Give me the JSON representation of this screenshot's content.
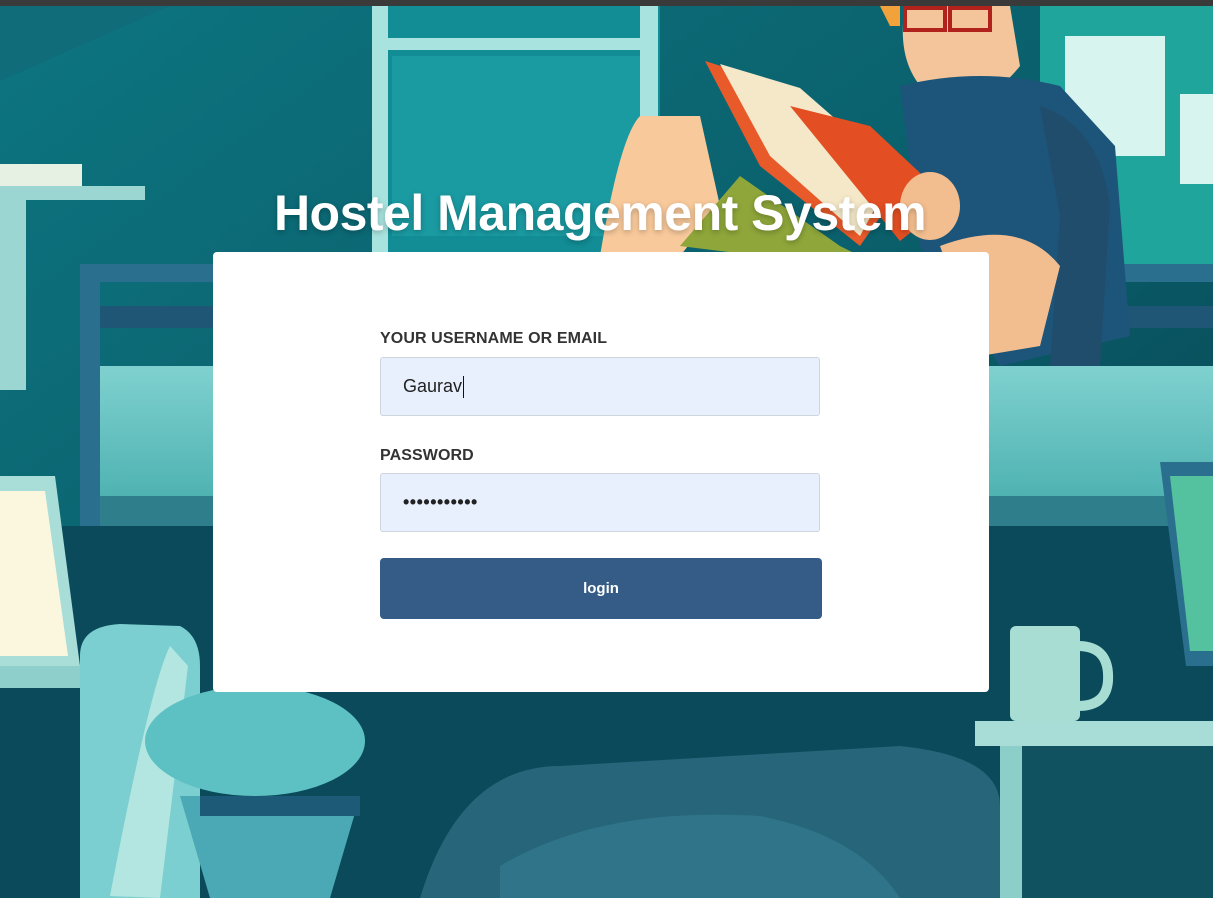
{
  "header": {
    "title": "Hostel Management System"
  },
  "form": {
    "username_label": "YOUR USERNAME OR EMAIL",
    "username_value": "Gaurav",
    "password_label": "PASSWORD",
    "password_mask": "•••••••••••",
    "login_label": "login"
  },
  "colors": {
    "background_teal": "#0b5f6c",
    "input_fill": "#e8f0fe",
    "button_fill": "#345c87",
    "card": "#ffffff"
  },
  "icons": [
    "student-reading-illustration"
  ]
}
